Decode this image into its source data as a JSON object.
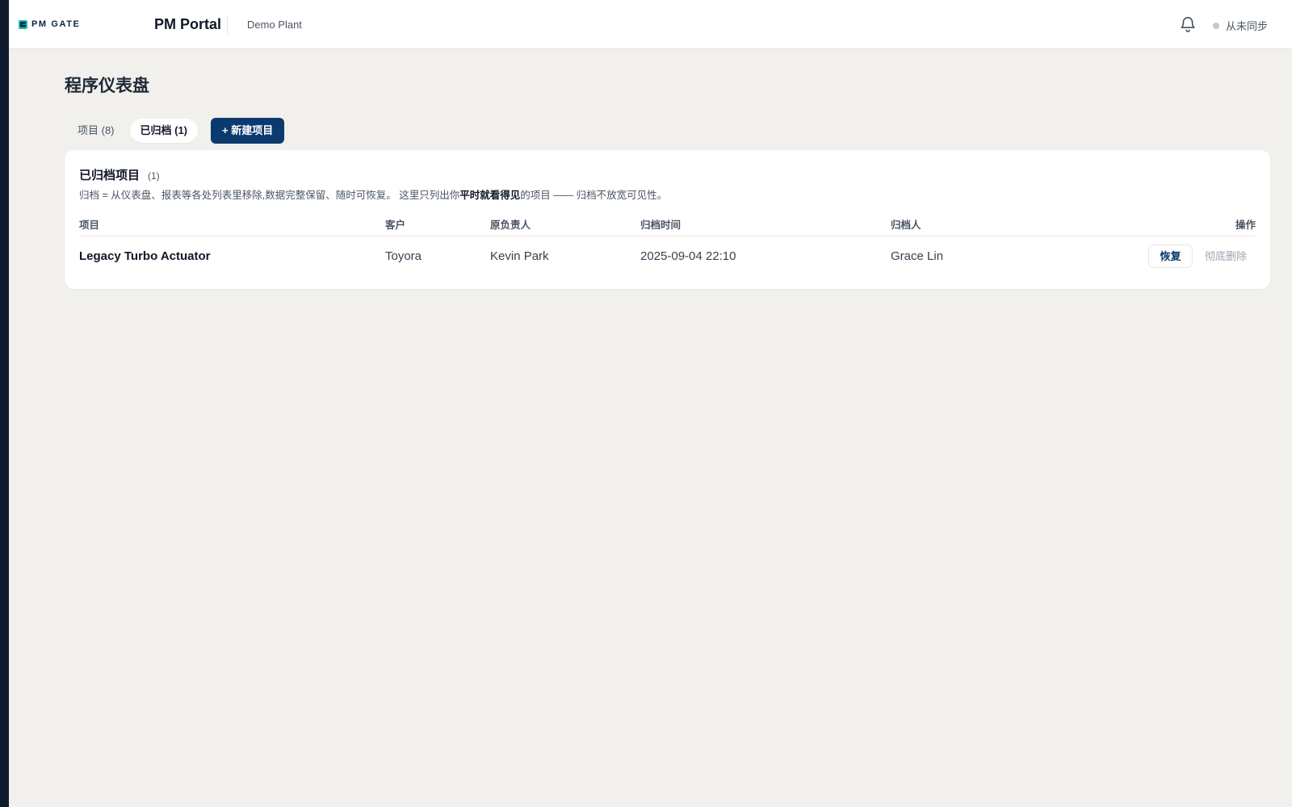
{
  "brand": {
    "logo_text": "PM GATE",
    "accent": "#14c1a6",
    "primary": "#0b3a6e"
  },
  "header": {
    "app_title": "PM Portal",
    "plant": "Demo Plant",
    "sync_status": "从未同步",
    "icons": [
      "bell-icon"
    ]
  },
  "page": {
    "title": "程序仪表盘"
  },
  "tabs": [
    {
      "label": "项目 (8)",
      "active": false
    },
    {
      "label": "已归档 (1)",
      "active": true
    }
  ],
  "new_project_label": "+ 新建项目",
  "archive": {
    "title": "已归档项目",
    "count": "(1)",
    "desc_before": "归档 = 从仪表盘、报表等各处列表里移除,数据完整保留、随时可恢复。 这里只列出你",
    "desc_bold": "平时就看得见",
    "desc_after": "的项目 —— 归档不放宽可见性。",
    "columns": {
      "project": "项目",
      "customer": "客户",
      "owner": "原负责人",
      "archived_at": "归档时间",
      "archived_by": "归档人",
      "actions": "操作"
    },
    "rows": [
      {
        "project": "Legacy Turbo Actuator",
        "customer": "Toyora",
        "owner": "Kevin Park",
        "archived_at": "2025-09-04 22:10",
        "archived_by": "Grace Lin",
        "restore_label": "恢复",
        "delete_label": "彻底删除"
      }
    ]
  }
}
